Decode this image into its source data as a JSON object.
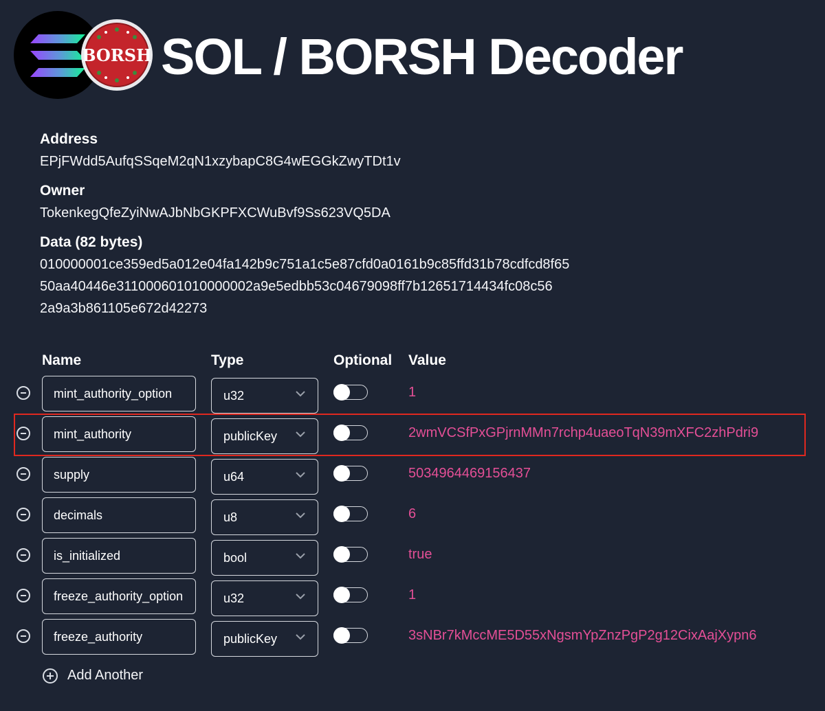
{
  "header": {
    "title": "SOL / BORSH Decoder",
    "logo_text": "BORSH"
  },
  "account": {
    "address_label": "Address",
    "address": "EPjFWdd5AufqSSqeM2qN1xzybapC8G4wEGGkZwyTDt1v",
    "owner_label": "Owner",
    "owner": "TokenkegQfeZyiNwAJbNbGKPFXCWuBvf9Ss623VQ5DA",
    "data_label": "Data (82 bytes)",
    "data_lines": [
      "010000001ce359ed5a012e04fa142b9c751a1c5e87cfd0a0161b9c85ffd31b78cdfcd8f65",
      "50aa40446e311000601010000002a9e5edbb53c04679098ff7b12651714434fc08c56",
      "2a9a3b861105e672d42273"
    ]
  },
  "table": {
    "headers": {
      "name": "Name",
      "type": "Type",
      "optional": "Optional",
      "value": "Value"
    },
    "rows": [
      {
        "name": "mint_authority_option",
        "type": "u32",
        "optional": false,
        "value": "1"
      },
      {
        "name": "mint_authority",
        "type": "publicKey",
        "optional": false,
        "value": "2wmVCSfPxGPjrnMMn7rchp4uaeoTqN39mXFC2zhPdri9",
        "highlighted": true
      },
      {
        "name": "supply",
        "type": "u64",
        "optional": false,
        "value": "5034964469156437"
      },
      {
        "name": "decimals",
        "type": "u8",
        "optional": false,
        "value": "6"
      },
      {
        "name": "is_initialized",
        "type": "bool",
        "optional": false,
        "value": "true"
      },
      {
        "name": "freeze_authority_option",
        "type": "u32",
        "optional": false,
        "value": "1"
      },
      {
        "name": "freeze_authority",
        "type": "publicKey",
        "optional": false,
        "value": "3sNBr7kMccME5D55xNgsmYpZnzPgP2g12CixAajXypn6"
      }
    ]
  },
  "actions": {
    "add_another_label": "Add Another"
  },
  "colors": {
    "background": "#1d2433",
    "value_pink": "#e44f96",
    "highlight_red": "#e0281f",
    "borsh_red": "#c4242b"
  },
  "icons": {
    "remove": "minus-circle-icon",
    "add": "plus-circle-icon",
    "dropdown": "chevron-down-icon"
  }
}
